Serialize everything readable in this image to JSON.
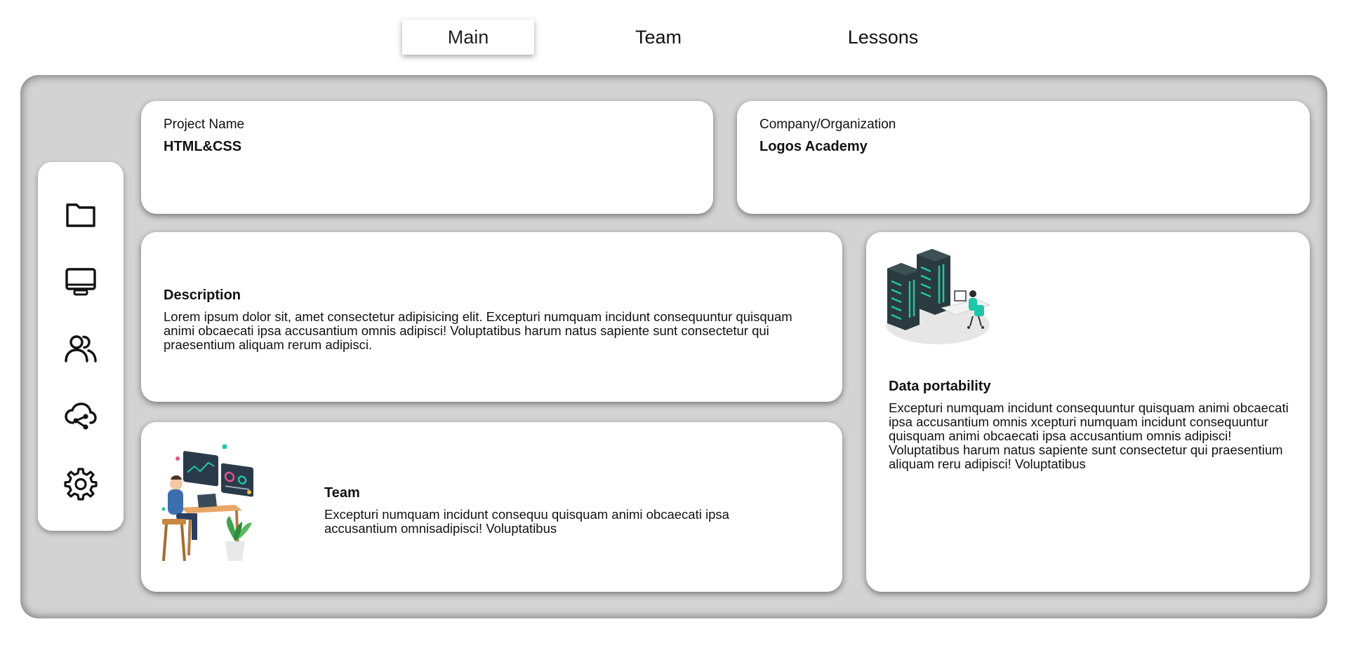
{
  "nav": {
    "tabs": [
      {
        "label": "Main",
        "active": true
      },
      {
        "label": "Team",
        "active": false
      },
      {
        "label": "Lessons",
        "active": false
      }
    ]
  },
  "sidebar": {
    "items": [
      {
        "icon": "folder-icon"
      },
      {
        "icon": "monitor-icon"
      },
      {
        "icon": "users-icon"
      },
      {
        "icon": "cloud-share-icon"
      },
      {
        "icon": "gear-icon"
      }
    ]
  },
  "project": {
    "label": "Project Name",
    "value": "HTML&CSS"
  },
  "company": {
    "label": "Company/Organization",
    "value": "Logos Academy"
  },
  "description": {
    "heading": "Description",
    "body": "Lorem ipsum dolor sit, amet consectetur adipisicing elit. Excepturi numquam incidunt consequuntur quisquam animi obcaecati ipsa accusantium omnis adipisci! Voluptatibus harum natus sapiente sunt consectetur qui praesentium aliquam rerum adipisci."
  },
  "team": {
    "heading": "Team",
    "body": "Excepturi numquam incidunt consequu quisquam animi obcaecati ipsa accusantium omnisadipisci! Voluptatibus"
  },
  "data_portability": {
    "heading": "Data portability",
    "body": "Excepturi numquam incidunt consequuntur quisquam animi obcaecati ipsa accusantium omnis xcepturi numquam incidunt consequuntur quisquam animi obcaecati ipsa accusantium omnis adipisci! Voluptatibus harum natus sapiente sunt consectetur qui praesentium aliquam reru adipisci! Voluptatibus"
  },
  "colors": {
    "panel_bg": "#d3d3d3",
    "card_bg": "#ffffff",
    "accent_teal": "#1fc6a8",
    "server_dark": "#2b3a3e"
  }
}
